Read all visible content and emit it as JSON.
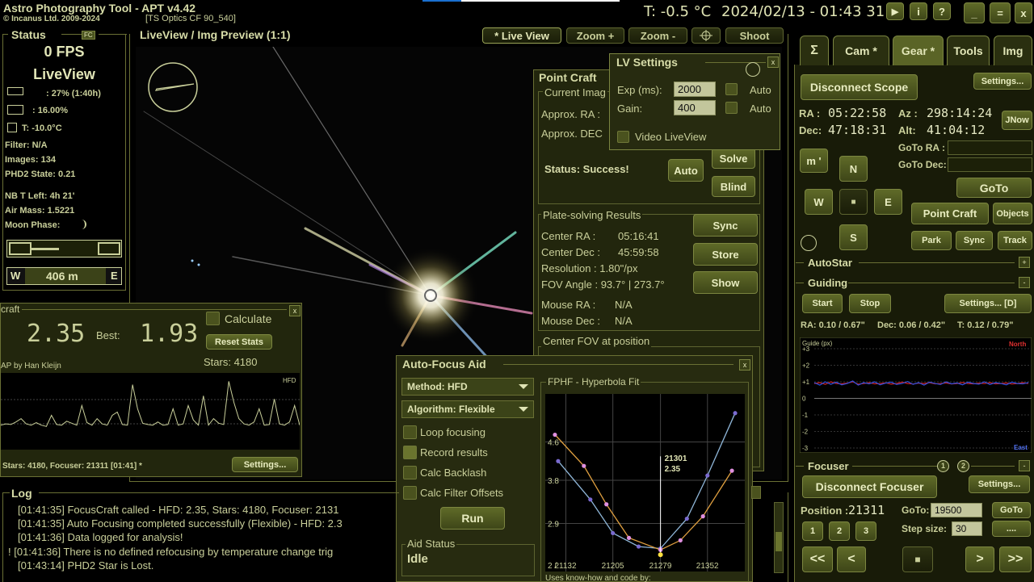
{
  "titlebar": {
    "app_title": "Astro Photography Tool  -  APT v4.42",
    "copyright": "© Incanus Ltd. 2009-2024",
    "optics": "[TS Optics CF 90_540]",
    "temperature": "T: -0.5 °C",
    "datetime": "2024/02/13 - 01:43 31",
    "btn_play": "▶",
    "btn_info": "i",
    "btn_help": "?",
    "btn_min": "_",
    "btn_max": "=",
    "btn_close": "x"
  },
  "status": {
    "header": "Status",
    "fc_badge": "FC",
    "fps": "0 FPS",
    "mode": "LiveView",
    "battery": ": 27% (1:40h)",
    "power": ": 16.00%",
    "temp": "T: -10.0°C",
    "filter": "Filter: N/A",
    "images": "Images: 134",
    "phd2": "PHD2 State: 0.21",
    "nb_left": "NB T Left: 4h 21'",
    "air_mass": "Air Mass: 1.5221",
    "moon_phase": "Moon Phase:",
    "compass_w": "W",
    "compass_val": "406 m",
    "compass_e": "E"
  },
  "liveview": {
    "title": "LiveView / Img Preview (1:1)",
    "btn_live": "* Live View",
    "btn_zoom_in": "Zoom +",
    "btn_zoom_out": "Zoom -",
    "btn_shoot": "Shoot"
  },
  "lv_settings": {
    "title": "LV Settings",
    "exp_label": "Exp (ms):",
    "exp_value": "2000",
    "gain_label": "Gain:",
    "gain_value": "400",
    "auto1": "Auto",
    "auto2": "Auto",
    "video": "Video LiveView"
  },
  "point_craft": {
    "title": "Point Craft",
    "current_img": "Current Imag",
    "approx_ra": "Approx. RA :",
    "approx_dec": "Approx. DEC",
    "status": "Status: Success!",
    "btn_auto": "Auto",
    "btn_solve": "Solve",
    "btn_blind": "Blind",
    "results_title": "Plate-solving Results",
    "center_ra_label": "Center RA :",
    "center_ra": "05:16:41",
    "center_dec_label": "Center Dec :",
    "center_dec": "45:59:58",
    "resolution": "Resolution : 1.80\"/px",
    "fov_angle": "FOV Angle : 93.7° | 273.7°",
    "mouse_ra_label": "Mouse RA :",
    "mouse_ra": "N/A",
    "mouse_dec_label": "Mouse Dec :",
    "mouse_dec": "N/A",
    "btn_sync": "Sync",
    "btn_store": "Store",
    "btn_show": "Show",
    "center_fov": "Center FOV at position"
  },
  "focus_craft": {
    "title": "craft",
    "hfd_value": "2.35",
    "best_label": "Best:",
    "best_value": "1.93",
    "calculate": "Calculate",
    "btn_reset": "Reset Stats",
    "stars": "Stars: 4180",
    "credit": "AP by Han Kleijn",
    "hfd_tag": "HFD",
    "footer": "Stars: 4180, Focuser: 21311 [01:41] *",
    "btn_settings": "Settings..."
  },
  "autofocus": {
    "title": "Auto-Focus Aid",
    "method": "Method: HFD",
    "algorithm": "Algorithm: Flexible",
    "loop": "Loop focusing",
    "record": "Record results",
    "backlash": "Calc Backlash",
    "filter_offsets": "Calc Filter Offsets",
    "btn_run": "Run",
    "aid_status_label": "Aid Status",
    "aid_status": "Idle",
    "fit_title": "FPHF - Hyperbola Fit",
    "point_label_1": "21301",
    "point_label_2": "2.35",
    "footer": "Uses know-how and code by:"
  },
  "log": {
    "title": "Log",
    "lines": [
      "[01:41:35] FocusCraft called - HFD: 2.35, Stars: 4180, Focuser: 2131",
      "[01:41:35] Auto Focusing completed successfully (Flexible) - HFD: 2.3",
      "[01:41:36] Data logged for analysis!",
      "! [01:41:36] There is no defined refocusing by temperature change trig",
      "[01:43:14] PHD2 Star is Lost."
    ]
  },
  "right_tabs": {
    "sigma": "Σ",
    "cam": "Cam *",
    "gear": "Gear *",
    "tools": "Tools",
    "img": "Img"
  },
  "scope": {
    "btn_disconnect": "Disconnect Scope",
    "btn_settings": "Settings...",
    "ra_label": "RA :",
    "ra": "05:22:58",
    "az_label": "Az :",
    "az": "298:14:24",
    "dec_label": "Dec:",
    "dec": "47:18:31",
    "alt_label": "Alt:",
    "alt": "41:04:12",
    "btn_jnow": "JNow",
    "btn_m": "m '",
    "btn_n": "N",
    "btn_w": "W",
    "btn_stop": "■",
    "btn_e": "E",
    "btn_s": "S",
    "goto_ra": "GoTo RA :",
    "goto_dec": "GoTo Dec:",
    "btn_goto": "GoTo",
    "btn_point_craft": "Point Craft",
    "btn_objects": "Objects",
    "btn_park": "Park",
    "btn_sync": "Sync",
    "btn_track": "Track",
    "autostar": "AutoStar"
  },
  "guiding": {
    "title": "Guiding",
    "btn_start": "Start",
    "btn_stop": "Stop",
    "btn_settings": "Settings... [D]",
    "stats_ra": "RA: 0.10 / 0.67\"",
    "stats_dec": "Dec: 0.06 / 0.42\"",
    "stats_t": "T: 0.12 / 0.79\"",
    "graph_label": "Guide (px)",
    "north": "North",
    "east": "East",
    "yticks": [
      "+3",
      "+2",
      "+1",
      "0",
      "-1",
      "-2",
      "-3"
    ]
  },
  "focuser": {
    "title": "Focuser",
    "badge1": "1",
    "badge2": "2",
    "btn_disconnect": "Disconnect Focuser",
    "btn_settings": "Settings...",
    "position_label": "Position :",
    "position": "21311",
    "goto_label": "GoTo:",
    "goto_value": "19500",
    "btn_goto": "GoTo",
    "btn_1": "1",
    "btn_2": "2",
    "btn_3": "3",
    "step_label": "Step size:",
    "step_value": "30",
    "btn_more": "....",
    "btn_ll": "<<",
    "btn_l": "<",
    "btn_stop": "■",
    "btn_r": ">",
    "btn_rr": ">>"
  },
  "chart_data": [
    {
      "type": "line",
      "title": "HFD",
      "xlabel": "",
      "ylabel": "",
      "series": [
        {
          "values": [
            0.3,
            0.32,
            0.31,
            0.35,
            0.4,
            0.32,
            0.3,
            0.34,
            0.3,
            0.28,
            0.45,
            0.31,
            0.3,
            0.36,
            0.33,
            0.3,
            0.6,
            0.34,
            0.3,
            0.4,
            0.32,
            0.3,
            0.45,
            0.5,
            0.31,
            0.3,
            0.92,
            0.55,
            0.33,
            0.31,
            0.3,
            0.35,
            0.3,
            0.31,
            0.55,
            0.3,
            0.32,
            0.6,
            0.38,
            0.3,
            0.75,
            0.3,
            0.4,
            0.33,
            0.31,
            0.97,
            0.65,
            0.4,
            0.32,
            0.3,
            0.35,
            0.55,
            0.3,
            0.31,
            0.7,
            0.32,
            0.3,
            0.35,
            0.6,
            0.3
          ]
        }
      ]
    },
    {
      "type": "scatter",
      "title": "FPHF - Hyperbola Fit",
      "x_ticks": [
        "21132",
        "21205",
        "21279",
        "21352"
      ],
      "y_ticks": [
        "4.6",
        "3.8",
        "2.9"
      ],
      "y_bottom_label": "2 /",
      "series": [
        {
          "color": "#8fb6d8",
          "points": [
            [
              21120,
              4.2
            ],
            [
              21170,
              3.4
            ],
            [
              21205,
              2.7
            ],
            [
              21245,
              2.42
            ],
            [
              21279,
              2.38
            ],
            [
              21320,
              3.0
            ],
            [
              21352,
              3.9
            ],
            [
              21395,
              5.2
            ]
          ]
        },
        {
          "color": "#e0a040",
          "points": [
            [
              21115,
              4.75
            ],
            [
              21160,
              4.1
            ],
            [
              21195,
              3.3
            ],
            [
              21230,
              2.6
            ],
            [
              21279,
              2.35
            ],
            [
              21310,
              2.55
            ],
            [
              21345,
              3.05
            ],
            [
              21390,
              4.0
            ]
          ]
        }
      ]
    },
    {
      "type": "line",
      "title": "Guide (px)",
      "ylim": [
        -3,
        3
      ],
      "series": [
        {
          "name": "North",
          "color": "#d02020",
          "values": [
            0.9,
            0.95,
            0.85,
            1.0,
            0.9,
            0.88,
            0.92,
            1.0,
            0.86,
            0.9,
            0.95,
            0.88,
            0.9,
            0.94,
            0.86,
            0.9,
            0.98,
            0.9,
            0.87,
            0.92,
            0.9,
            0.95,
            0.88,
            0.9,
            0.93,
            0.87,
            0.9,
            0.96,
            0.9,
            0.88,
            0.92,
            0.9,
            0.95,
            0.88,
            0.9,
            0.93,
            0.87,
            0.9,
            0.95,
            0.9
          ]
        },
        {
          "name": "East",
          "color": "#3050e0",
          "values": [
            0.95,
            0.8,
            1.0,
            0.85,
            0.98,
            0.82,
            0.9,
            1.05,
            0.8,
            0.95,
            0.88,
            1.0,
            0.82,
            0.92,
            0.98,
            0.84,
            0.9,
            1.02,
            0.85,
            0.95,
            0.8,
            0.98,
            0.9,
            0.84,
            1.0,
            0.88,
            0.93,
            0.82,
            0.98,
            0.9,
            0.86,
            1.0,
            0.84,
            0.95,
            0.9,
            0.82,
            0.98,
            0.9,
            0.88,
            0.95
          ]
        }
      ]
    }
  ],
  "colors": {
    "accent": "#5a6426",
    "panel": "#22260d",
    "border": "#6a7034"
  }
}
